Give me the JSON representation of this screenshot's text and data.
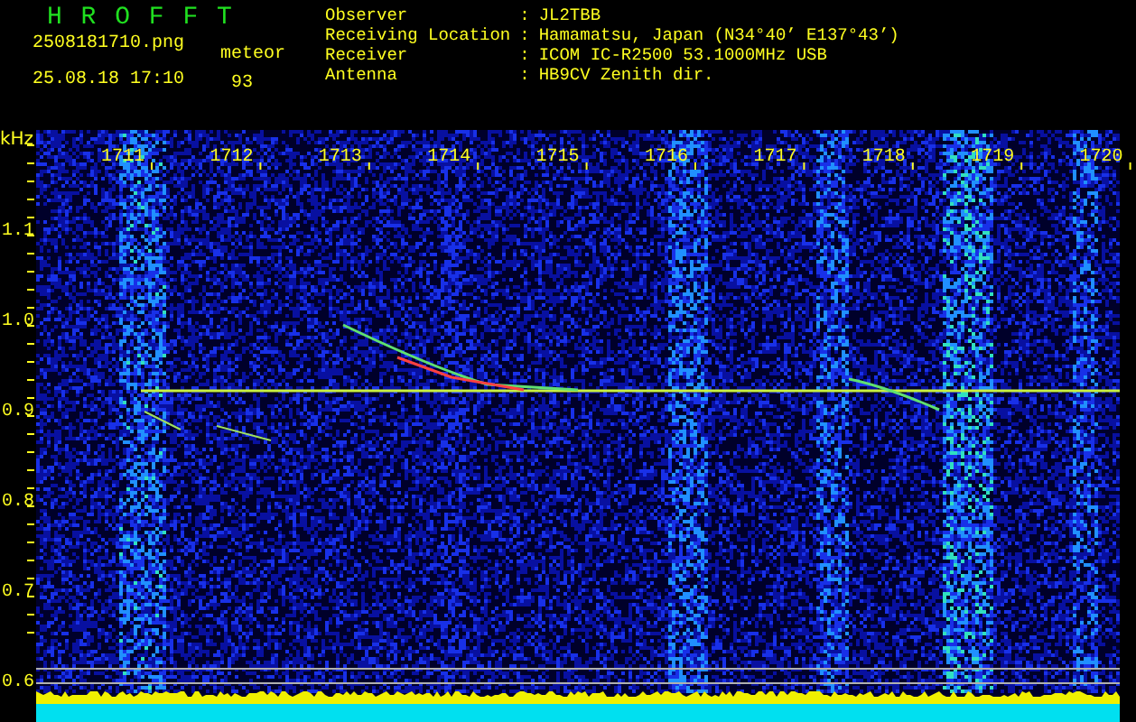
{
  "app_title": "H R O F F T",
  "file_name": "2508181710.png",
  "timestamp": "25.08.18 17:10",
  "count_label": "meteor",
  "count": "93",
  "info": [
    {
      "label": "Observer",
      "value": "JL2TBB"
    },
    {
      "label": "Receiving Location",
      "value": "Hamamatsu, Japan (N34°40’ E137°43’)"
    },
    {
      "label": "Receiver",
      "value": "ICOM IC-R2500 53.1000MHz USB"
    },
    {
      "label": "Antenna",
      "value": "HB9CV Zenith dir."
    }
  ],
  "separator": ":",
  "unit": "kHz",
  "freq_labels": [
    "1.1",
    "1.0",
    "0.9",
    "0.8",
    "0.7",
    "0.6"
  ],
  "time_labels": [
    "1711",
    "1712",
    "1713",
    "1714",
    "1715",
    "1716",
    "1717",
    "1718",
    "1719",
    "1720"
  ]
}
